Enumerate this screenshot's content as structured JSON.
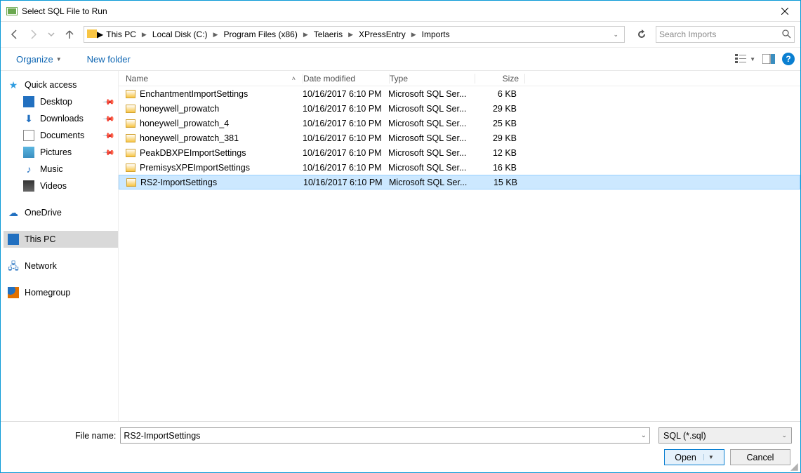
{
  "window": {
    "title": "Select SQL File to Run"
  },
  "breadcrumb": {
    "items": [
      "This PC",
      "Local Disk (C:)",
      "Program Files (x86)",
      "Telaeris",
      "XPressEntry",
      "Imports"
    ]
  },
  "search": {
    "placeholder": "Search Imports"
  },
  "toolbar": {
    "organize": "Organize",
    "newfolder": "New folder"
  },
  "sidebar": {
    "quick_access": "Quick access",
    "desktop": "Desktop",
    "downloads": "Downloads",
    "documents": "Documents",
    "pictures": "Pictures",
    "music": "Music",
    "videos": "Videos",
    "onedrive": "OneDrive",
    "this_pc": "This PC",
    "network": "Network",
    "homegroup": "Homegroup"
  },
  "columns": {
    "name": "Name",
    "date": "Date modified",
    "type": "Type",
    "size": "Size"
  },
  "files": [
    {
      "name": "EnchantmentImportSettings",
      "date": "10/16/2017 6:10 PM",
      "type": "Microsoft SQL Ser...",
      "size": "6 KB",
      "selected": false
    },
    {
      "name": "honeywell_prowatch",
      "date": "10/16/2017 6:10 PM",
      "type": "Microsoft SQL Ser...",
      "size": "29 KB",
      "selected": false
    },
    {
      "name": "honeywell_prowatch_4",
      "date": "10/16/2017 6:10 PM",
      "type": "Microsoft SQL Ser...",
      "size": "25 KB",
      "selected": false
    },
    {
      "name": "honeywell_prowatch_381",
      "date": "10/16/2017 6:10 PM",
      "type": "Microsoft SQL Ser...",
      "size": "29 KB",
      "selected": false
    },
    {
      "name": "PeakDBXPEImportSettings",
      "date": "10/16/2017 6:10 PM",
      "type": "Microsoft SQL Ser...",
      "size": "12 KB",
      "selected": false
    },
    {
      "name": "PremisysXPEImportSettings",
      "date": "10/16/2017 6:10 PM",
      "type": "Microsoft SQL Ser...",
      "size": "16 KB",
      "selected": false
    },
    {
      "name": "RS2-ImportSettings",
      "date": "10/16/2017 6:10 PM",
      "type": "Microsoft SQL Ser...",
      "size": "15 KB",
      "selected": true
    }
  ],
  "footer": {
    "filename_label": "File name:",
    "filename_value": "RS2-ImportSettings",
    "filter": "SQL (*.sql)",
    "open": "Open",
    "cancel": "Cancel"
  }
}
